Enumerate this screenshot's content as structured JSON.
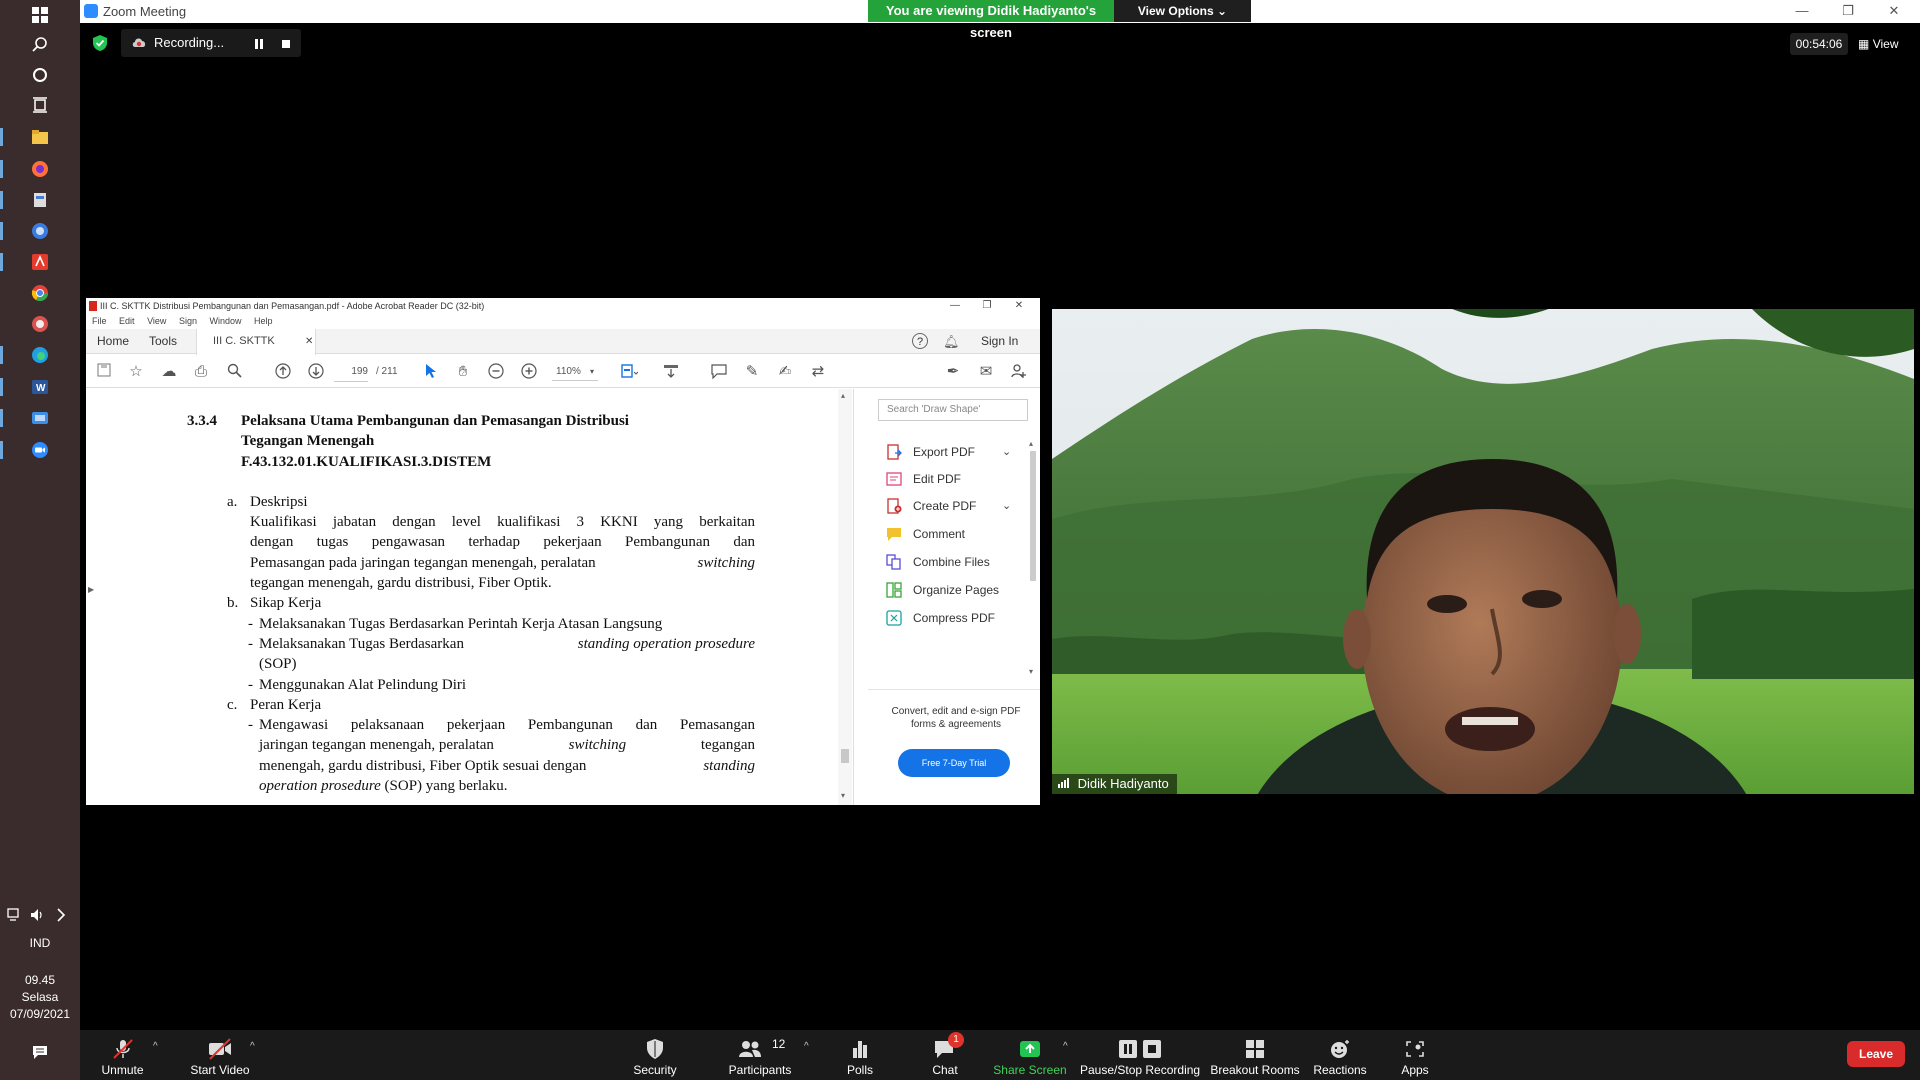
{
  "taskbar": {
    "language": "IND",
    "time": "09.45",
    "day": "Selasa",
    "date": "07/09/2021"
  },
  "zoom": {
    "window_title": "Zoom Meeting",
    "banner": "You are viewing Didik Hadiyanto's screen",
    "view_options": "View Options",
    "recording_label": "Recording...",
    "timer": "00:54:06",
    "view_label": "View",
    "participant_name": "Didik Hadiyanto",
    "participants_count": "12",
    "chat_badge": "1",
    "controls": {
      "unmute": "Unmute",
      "start_video": "Start Video",
      "security": "Security",
      "participants": "Participants",
      "polls": "Polls",
      "chat": "Chat",
      "share_screen": "Share Screen",
      "pause_stop_recording": "Pause/Stop Recording",
      "breakout_rooms": "Breakout Rooms",
      "reactions": "Reactions",
      "apps": "Apps",
      "leave": "Leave"
    }
  },
  "acrobat": {
    "title": "III C. SKTTK Distribusi Pembangunan dan Pemasangan.pdf - Adobe Acrobat Reader DC (32-bit)",
    "menu": [
      "File",
      "Edit",
      "View",
      "Sign",
      "Window",
      "Help"
    ],
    "tab_home": "Home",
    "tab_tools": "Tools",
    "doc_tab": "III C. SKTTK Distrib...",
    "sign_in": "Sign In",
    "page_current": "199",
    "page_total": "/ 211",
    "zoom": "110%",
    "search_placeholder": "Search 'Draw Shape'",
    "tools": [
      "Export PDF",
      "Edit PDF",
      "Create PDF",
      "Comment",
      "Combine Files",
      "Organize Pages",
      "Compress PDF"
    ],
    "promo_text": "Convert, edit and e-sign PDF forms & agreements",
    "trial_button": "Free 7-Day Trial",
    "doc": {
      "section_no": "3.3.4",
      "section_title_1": "Pelaksana Utama Pembangunan dan Pemasangan Distribusi",
      "section_title_2": "Tegangan Menengah",
      "section_code": "F.43.132.01.KUALIFIKASI.3.DISTEM",
      "a_label": "a.",
      "a_title": "Deskripsi",
      "a_text_1": "Kualifikasi jabatan dengan level kualifikasi 3 KKNI yang berkaitan",
      "a_text_2": "dengan tugas pengawasan terhadap pekerjaan Pembangunan dan",
      "a_text_3a": "Pemasangan pada jaringan tegangan menengah, peralatan",
      "a_text_3b": "switching",
      "a_text_4": "tegangan menengah, gardu distribusi, Fiber Optik.",
      "b_label": "b.",
      "b_title": "Sikap Kerja",
      "b_item_1": "Melaksanakan Tugas Berdasarkan Perintah Kerja Atasan Langsung",
      "b_item_2a": "Melaksanakan Tugas Berdasarkan",
      "b_item_2b": "standing operation prosedure",
      "b_item_2c": "(SOP)",
      "b_item_3": "Menggunakan Alat Pelindung Diri",
      "c_label": "c.",
      "c_title": "Peran Kerja",
      "c_item_1a": "Mengawasi pelaksanaan pekerjaan Pembangunan dan Pemasangan",
      "c_item_1b": "jaringan tegangan menengah, peralatan",
      "c_item_1c": "switching",
      "c_item_1d": "tegangan",
      "c_item_1e": "menengah, gardu distribusi, Fiber Optik sesuai dengan",
      "c_item_1f": "standing",
      "c_item_1g": "operation prosedure",
      "c_item_1h": "(SOP) yang berlaku.",
      "bullet": "-"
    }
  }
}
